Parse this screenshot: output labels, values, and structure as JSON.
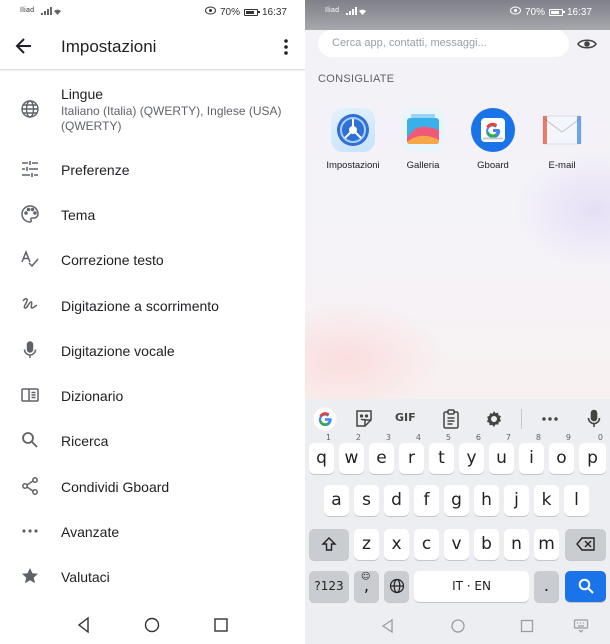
{
  "left": {
    "status": {
      "carrier": "Iliad",
      "battery": "70%",
      "time": "16:37"
    },
    "title": "Impostazioni",
    "items": [
      {
        "label": "Lingue",
        "sub": "Italiano (Italia) (QWERTY), Inglese (USA) (QWERTY)",
        "icon": "globe-icon"
      },
      {
        "label": "Preferenze",
        "icon": "sliders-icon"
      },
      {
        "label": "Tema",
        "icon": "palette-icon"
      },
      {
        "label": "Correzione testo",
        "icon": "spellcheck-icon"
      },
      {
        "label": "Digitazione a scorrimento",
        "icon": "gesture-icon"
      },
      {
        "label": "Digitazione vocale",
        "icon": "mic-icon"
      },
      {
        "label": "Dizionario",
        "icon": "book-icon"
      },
      {
        "label": "Ricerca",
        "icon": "search-icon"
      },
      {
        "label": "Condividi Gboard",
        "icon": "share-icon"
      },
      {
        "label": "Avanzate",
        "icon": "more-horiz-icon"
      },
      {
        "label": "Valutaci",
        "icon": "star-icon"
      }
    ]
  },
  "right": {
    "status": {
      "carrier": "Iliad",
      "battery": "70%",
      "time": "16:37"
    },
    "search_placeholder": "Cerca app, contatti, messaggi...",
    "section_title": "CONSIGLIATE",
    "apps": [
      {
        "name": "Impostazioni",
        "icon": "settings-app-icon"
      },
      {
        "name": "Galleria",
        "icon": "gallery-app-icon"
      },
      {
        "name": "Gboard",
        "icon": "gboard-app-icon"
      },
      {
        "name": "E-mail",
        "icon": "email-app-icon"
      }
    ],
    "keyboard": {
      "toolbar": [
        "google-icon",
        "sticker-icon",
        "GIF",
        "clipboard-icon",
        "gear-icon",
        "more-icon",
        "mic-icon"
      ],
      "gif_label": "GIF",
      "row1": [
        {
          "k": "q",
          "h": "1"
        },
        {
          "k": "w",
          "h": "2"
        },
        {
          "k": "e",
          "h": "3"
        },
        {
          "k": "r",
          "h": "4"
        },
        {
          "k": "t",
          "h": "5"
        },
        {
          "k": "y",
          "h": "6"
        },
        {
          "k": "u",
          "h": "7"
        },
        {
          "k": "i",
          "h": "8"
        },
        {
          "k": "o",
          "h": "9"
        },
        {
          "k": "p",
          "h": "0"
        }
      ],
      "row2": [
        "a",
        "s",
        "d",
        "f",
        "g",
        "h",
        "j",
        "k",
        "l"
      ],
      "row3": [
        "z",
        "x",
        "c",
        "v",
        "b",
        "n",
        "m"
      ],
      "numbers_label": "?123",
      "comma": ",",
      "space_label": "IT · EN",
      "period": "."
    },
    "accent_color": "#1a73e8"
  }
}
